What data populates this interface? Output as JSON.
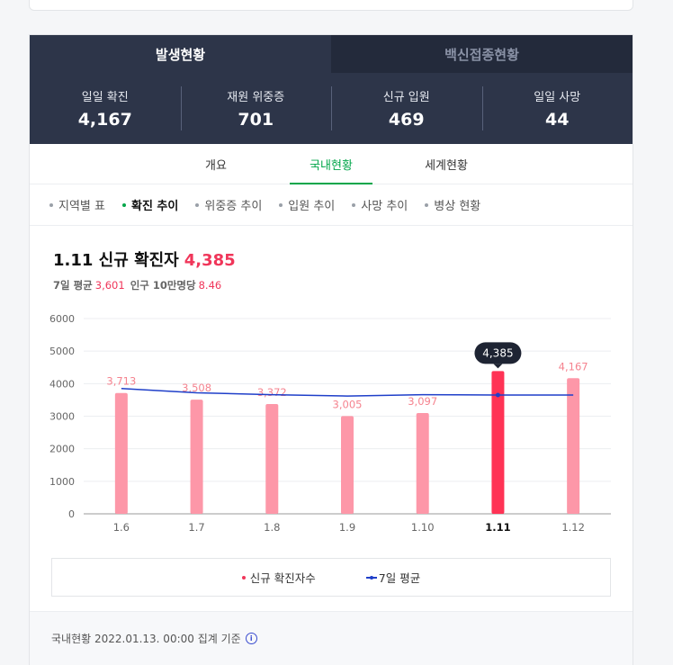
{
  "tabs": [
    "발생현황",
    "백신접종현황"
  ],
  "stats": [
    {
      "label": "일일 확진",
      "value": "4,167"
    },
    {
      "label": "재원 위중증",
      "value": "701"
    },
    {
      "label": "신규 입원",
      "value": "469"
    },
    {
      "label": "일일 사망",
      "value": "44"
    }
  ],
  "subtabs": [
    "개요",
    "국내현황",
    "세계현황"
  ],
  "chips": [
    "지역별 표",
    "확진 추이",
    "위중증 추이",
    "입원 추이",
    "사망 추이",
    "병상 현황"
  ],
  "headline": {
    "title": "1.11 신규 확진자",
    "value": "4,385"
  },
  "subline": {
    "avg_label": "7일 평균",
    "avg_value": "3,601",
    "pop_label": "인구 10만명당",
    "pop_value": "8.46"
  },
  "chart_data": {
    "type": "bar",
    "categories": [
      "1.6",
      "1.7",
      "1.8",
      "1.9",
      "1.10",
      "1.11",
      "1.12"
    ],
    "ylim": [
      0,
      6000
    ],
    "y_ticks": [
      "0",
      "1000",
      "2000",
      "3000",
      "4000",
      "5000",
      "6000"
    ],
    "series": [
      {
        "name": "신규 확진자수",
        "type": "bar",
        "values": [
          3713,
          3508,
          3372,
          3005,
          3097,
          4385,
          4167
        ],
        "labels": [
          "3,713",
          "3,508",
          "3,372",
          "3,005",
          "3,097",
          "4,385",
          "4,167"
        ]
      },
      {
        "name": "7일 평균",
        "type": "line",
        "values": [
          3850,
          3720,
          3660,
          3620,
          3660,
          3650,
          3650
        ]
      }
    ],
    "highlight_index": 5,
    "colors": {
      "bar": "#fd97a8",
      "highlight": "#ff3355",
      "line": "#1f3fc9",
      "label": "#f5838f"
    },
    "grid": true
  },
  "legend": {
    "bar_label": "신규 확진자수",
    "line_label": "7일 평균"
  },
  "footer": {
    "text": "국내현황 2022.01.13. 00:00 집계 기준",
    "info_icon": "info-icon"
  }
}
